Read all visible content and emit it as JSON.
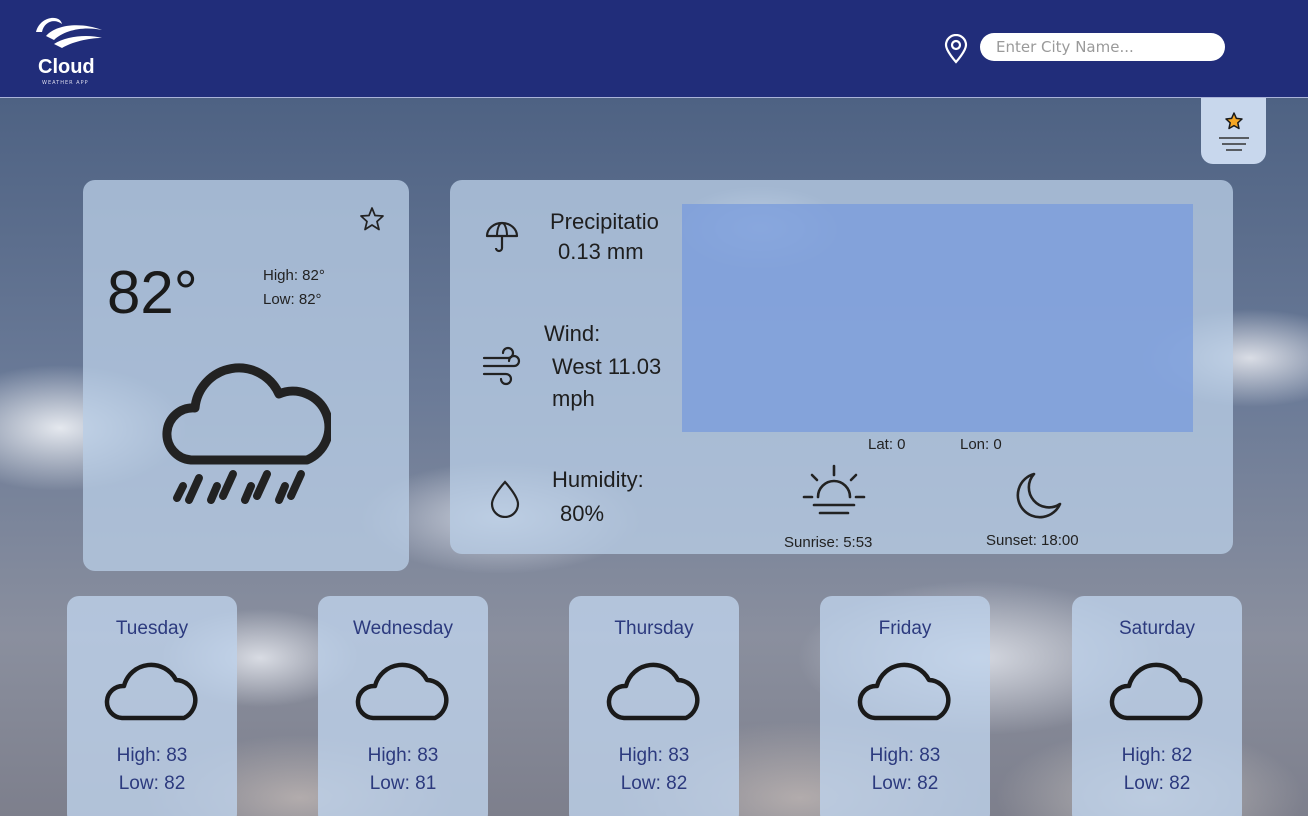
{
  "header": {
    "logo_name": "Cloud",
    "logo_sub": "WEATHER APP",
    "search_placeholder": "Enter City Name..."
  },
  "current": {
    "temp": "82°",
    "high": "High: 82°",
    "low": "Low: 82°",
    "condition_icon": "cloud-rain-icon"
  },
  "details": {
    "precipitation_label": "Precipitatio",
    "precipitation_value": "0.13 mm",
    "wind_label": "Wind:",
    "wind_value_1": "West 11.03",
    "wind_value_2": "mph",
    "humidity_label": "Humidity:",
    "humidity_value": "80%",
    "lat": "Lat: 0",
    "lon": "Lon: 0",
    "sunrise": "Sunrise: 5:53",
    "sunset": "Sunset: 18:00"
  },
  "forecast": [
    {
      "day": "Tuesday",
      "high": "High: 83",
      "low": "Low: 82",
      "icon": "cloud-icon"
    },
    {
      "day": "Wednesday",
      "high": "High: 83",
      "low": "Low: 81",
      "icon": "cloud-icon"
    },
    {
      "day": "Thursday",
      "high": "High: 83",
      "low": "Low: 82",
      "icon": "cloud-icon"
    },
    {
      "day": "Friday",
      "high": "High: 83",
      "low": "Low: 82",
      "icon": "cloud-icon"
    },
    {
      "day": "Saturday",
      "high": "High: 82",
      "low": "Low: 82",
      "icon": "cloud-icon"
    }
  ],
  "colors": {
    "header_bg": "#212d7a",
    "forecast_text": "#2c3a7e",
    "favorite_star": "#f5a623"
  }
}
